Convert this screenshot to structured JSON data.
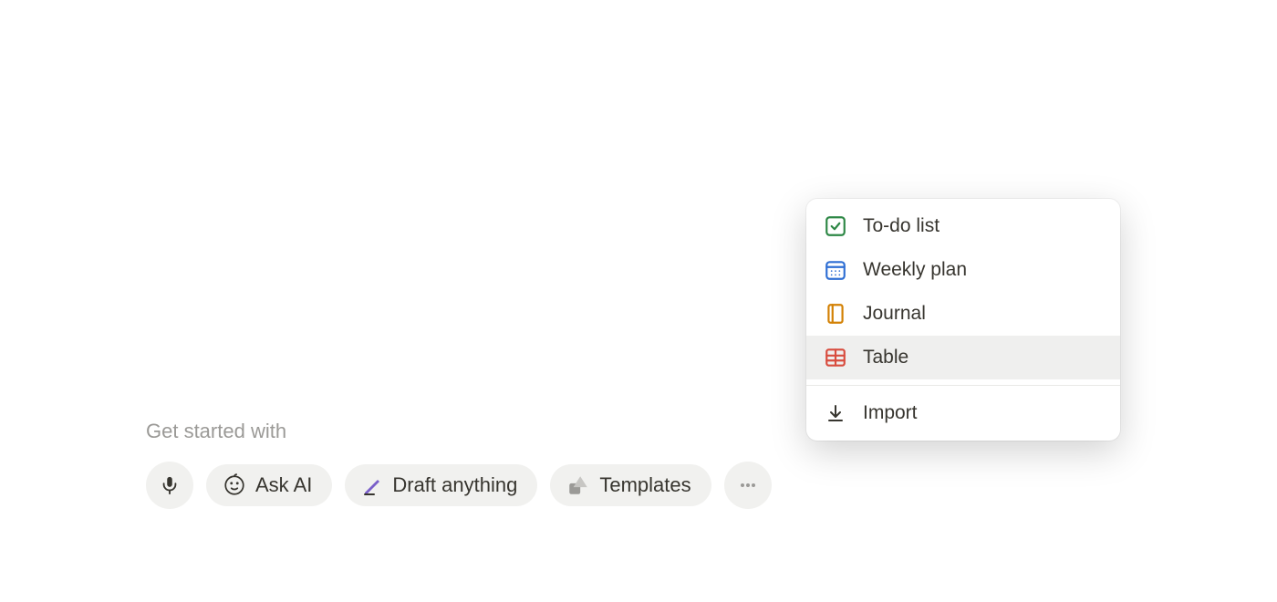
{
  "prompt": {
    "label": "Get started with"
  },
  "actions": {
    "ask_ai_label": "Ask AI",
    "draft_label": "Draft anything",
    "templates_label": "Templates"
  },
  "popover": {
    "items": [
      {
        "label": "To-do list",
        "icon": "checkbox-icon",
        "color": "#2d8745"
      },
      {
        "label": "Weekly plan",
        "icon": "calendar-icon",
        "color": "#2f6fd4"
      },
      {
        "label": "Journal",
        "icon": "journal-icon",
        "color": "#d38104"
      },
      {
        "label": "Table",
        "icon": "table-icon",
        "color": "#d84c3e",
        "hovered": true
      }
    ],
    "import_label": "Import"
  }
}
